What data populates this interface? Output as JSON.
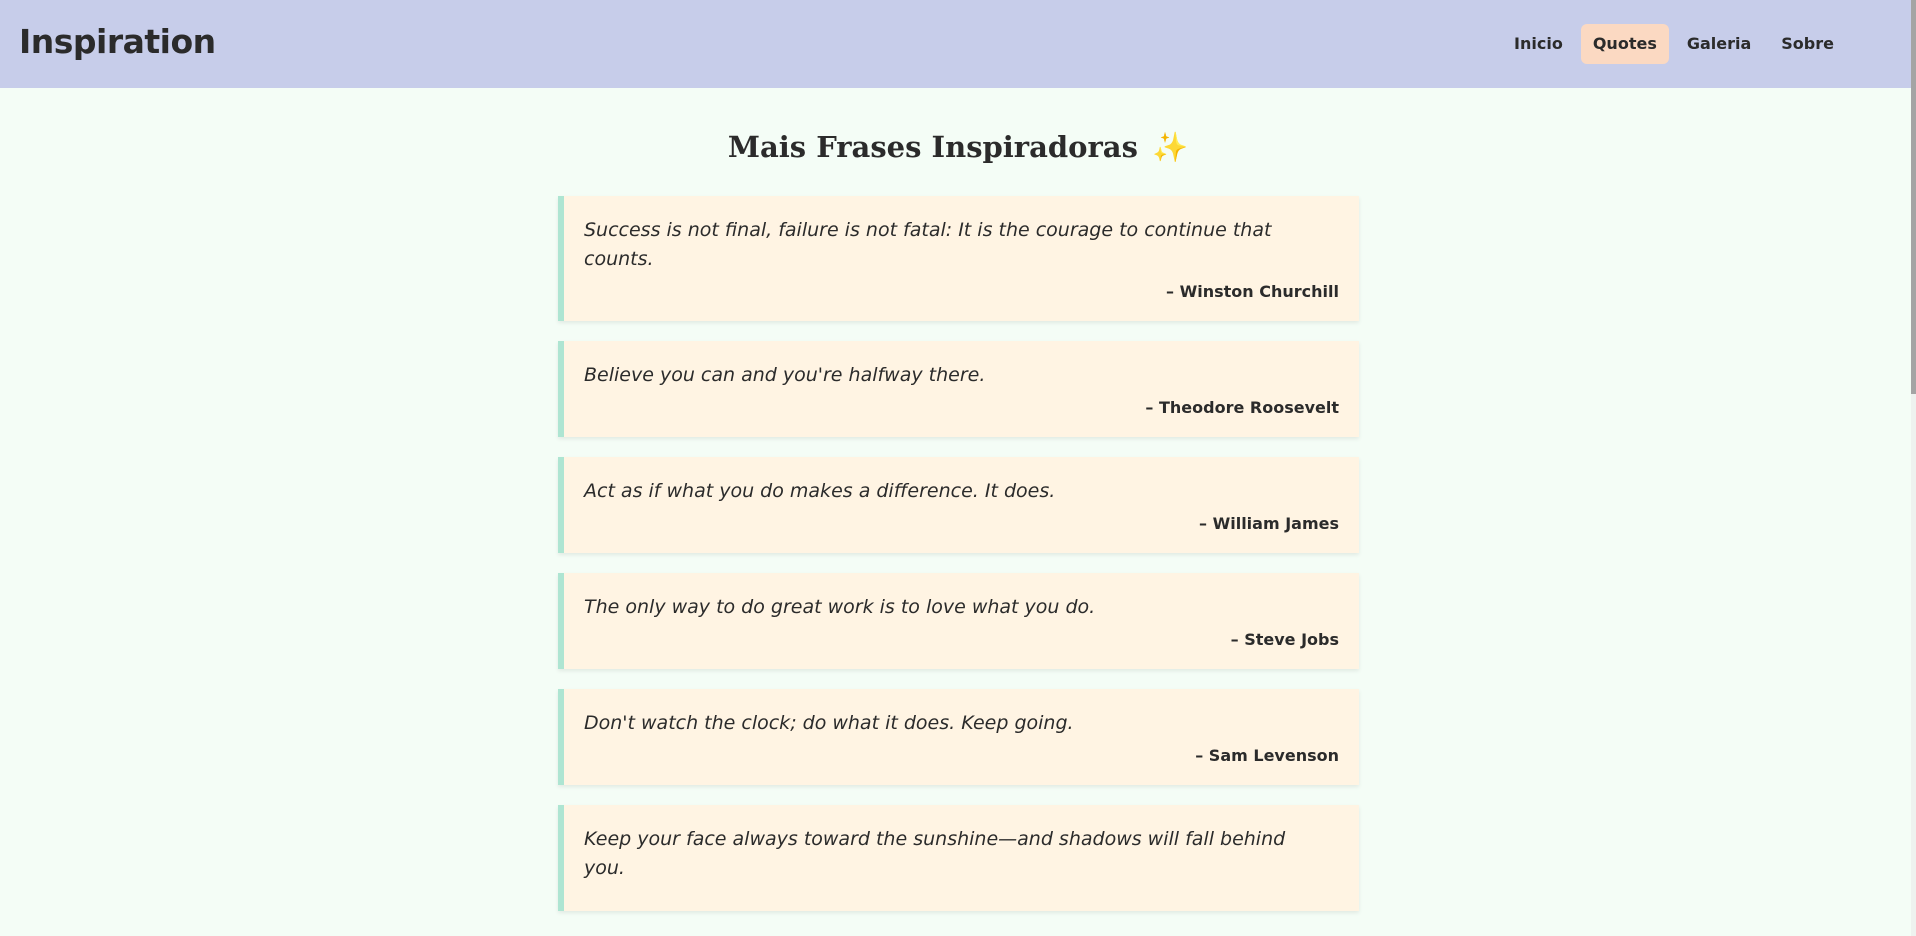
{
  "header": {
    "brand": "Inspiration",
    "nav": [
      {
        "label": "Inicio",
        "active": false
      },
      {
        "label": "Quotes",
        "active": true
      },
      {
        "label": "Galeria",
        "active": false
      },
      {
        "label": "Sobre",
        "active": false
      }
    ]
  },
  "main": {
    "title": "Mais Frases Inspiradoras",
    "title_emoji": "✨",
    "quotes": [
      {
        "text": "Success is not final, failure is not fatal: It is the courage to continue that counts.",
        "author": "– Winston Churchill"
      },
      {
        "text": "Believe you can and you're halfway there.",
        "author": "– Theodore Roosevelt"
      },
      {
        "text": "Act as if what you do makes a difference. It does.",
        "author": "– William James"
      },
      {
        "text": "The only way to do great work is to love what you do.",
        "author": "– Steve Jobs"
      },
      {
        "text": "Don't watch the clock; do what it does. Keep going.",
        "author": "– Sam Levenson"
      },
      {
        "text": "Keep your face always toward the sunshine—and shadows will fall behind you.",
        "author": ""
      }
    ]
  },
  "colors": {
    "header_bg": "#c7cdea",
    "page_bg": "#f4fdf6",
    "active_nav_bg": "#fbd9c2",
    "card_bg": "#fff4e3",
    "card_accent": "#aee5d2"
  }
}
